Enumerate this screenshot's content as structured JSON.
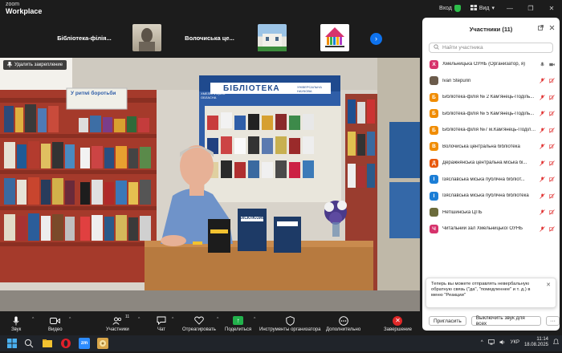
{
  "app": {
    "brand_line1": "zoom",
    "brand_line2": "Workplace"
  },
  "titlebar": {
    "signin_label": "Вход",
    "view_label": "Вид",
    "view_caret": "▾",
    "minimize": "—",
    "restore": "❐",
    "close": "✕"
  },
  "thumbnails": [
    {
      "label": "Бібліотека-філія..."
    },
    {
      "label": "Волочиська  це..."
    }
  ],
  "video": {
    "unpin_label": "Удалить закрепление",
    "banner_text": "БІБЛІОТЕКА",
    "banner_left": "ХМЕЛЬНИЦЬКА ОБЛАСНА",
    "banner_right": "УНІВЕРСАЛЬНА НАУКОВА",
    "sign_text": "У ритмі боротьби",
    "book_title": "ЕКСКЛЮЗИВ"
  },
  "participants": {
    "title": "Участники (11)",
    "search_placeholder": "Найти участника",
    "items": [
      {
        "initial": "Х",
        "color": "#d6336c",
        "name": "Хмельницька ОУНБ (Организатор, я)",
        "video_off": false
      },
      {
        "initial": "",
        "color": "#6b5b4b",
        "name": "Ivan Stepurin",
        "video_off": true
      },
      {
        "initial": "Б",
        "color": "#f08c00",
        "name": "Бібліотека-філія № 2 Кам'янець-Поділь...",
        "video_off": true
      },
      {
        "initial": "Б",
        "color": "#f08c00",
        "name": "Бібліотека-філія № 5 Кам'янець-Поділь...",
        "video_off": true
      },
      {
        "initial": "Б",
        "color": "#f08c00",
        "name": "Бібліотека-філія №7 м.Кам'янець-Поділь...",
        "video_off": true
      },
      {
        "initial": "В",
        "color": "#f08c00",
        "name": "Волочиська центральна бібліотека",
        "video_off": true
      },
      {
        "initial": "Д",
        "color": "#e8590c",
        "name": "Деражнянська центральна міська бі...",
        "video_off": true
      },
      {
        "initial": "І",
        "color": "#1c7ed6",
        "name": "Ізяславська міська публічна бібліот...",
        "video_off": true
      },
      {
        "initial": "І",
        "color": "#1c7ed6",
        "name": "Ізяславська міська публічна бібліотека",
        "video_off": true
      },
      {
        "initial": "",
        "color": "#6b6b3b",
        "name": "Нетішинська ЦПБ",
        "video_off": true
      },
      {
        "initial": "Ч",
        "color": "#d6336c",
        "name": "Читальний зал Хмельницької ОУНБ",
        "video_off": true
      }
    ],
    "notice": "Теперь вы можете отправлять невербальную обратную связь (\"да\", \"помедленнее\" и т. д.) в меню \"Реакции\"",
    "notice_close": "✕",
    "invite_label": "Пригласить",
    "mute_all_label": "Выключить звук для всех",
    "more_label": "···"
  },
  "toolbar": {
    "audio": "Звук",
    "video": "Видео",
    "participants": "Участники",
    "participants_count": "11",
    "chat": "Чат",
    "react": "Отреагировать",
    "share": "Поделиться",
    "host_tools": "Инструменты организатора",
    "more": "Дополнительно",
    "end": "Завершение"
  },
  "taskbar": {
    "lang": "УКР",
    "time": "11:14",
    "date": "18.08.2025",
    "zoom_app_label": "zm"
  },
  "colors": {
    "accent": "#0e72ed",
    "share_green": "#22b24c",
    "end_red": "#e02828",
    "mute_red": "#e03131"
  }
}
